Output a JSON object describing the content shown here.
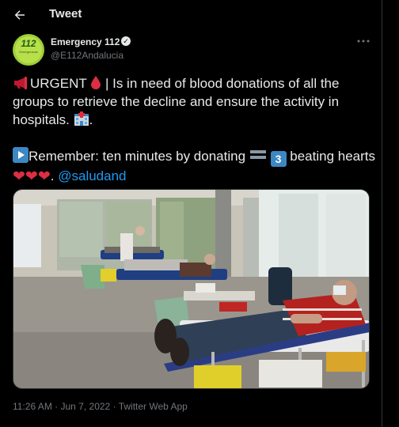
{
  "header": {
    "title": "Tweet"
  },
  "author": {
    "name": "Emergency 112",
    "handle": "@E112Andalucia",
    "avatar_text": "112",
    "avatar_subtext": "Emergencias"
  },
  "tweet": {
    "line1_urgent": "URGENT",
    "line1_rest": "| Is in need of blood donations of all the groups to retrieve the decline and ensure the activity in hospitals.",
    "line1_end": ".",
    "line2_a": "Remember: ten minutes by donating",
    "line2_b": "beating hearts",
    "line2_dot": ".",
    "mention": "@saludand",
    "hearts": "❤❤❤"
  },
  "meta": {
    "time": "11:26 AM",
    "sep": "·",
    "date": "Jun 7, 2022",
    "source": "Twitter Web App"
  },
  "icons": {
    "back": "arrow-left-icon",
    "verified": "verified-badge-icon",
    "more": "more-horizontal-icon"
  },
  "colors": {
    "background": "#000000",
    "text": "#e7e9ea",
    "secondary": "#71767b",
    "link": "#1d9bf0",
    "heart": "#dd2e44"
  }
}
